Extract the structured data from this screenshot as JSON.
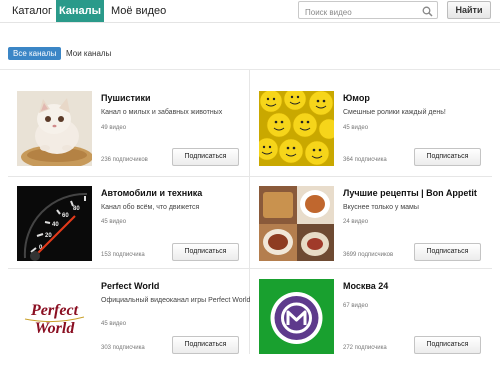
{
  "nav": {
    "tabs": [
      "Каталог",
      "Каналы",
      "Моё видео"
    ],
    "search_placeholder": "Поиск видео",
    "find_label": "Найти"
  },
  "filters": {
    "all": "Все каналы",
    "mine": "Мои каналы"
  },
  "colors": {
    "active_tab": "#2a9a8a",
    "active_pill": "#3b86c6"
  },
  "cards": [
    {
      "title": "Пушистики",
      "description": "Канал о милых и забавных животных",
      "videos": "49 видео",
      "subscribers": "236 подписчиков",
      "button": "Подписаться",
      "thumbnail": "kitten-photo"
    },
    {
      "title": "Юмор",
      "description": "Смешные ролики каждый день!",
      "videos": "45 видео",
      "subscribers": "364 подписчика",
      "button": "Подписаться",
      "thumbnail": "smiley-balls"
    },
    {
      "title": "Автомобили и техника",
      "description": "Канал обо всём, что движется",
      "videos": "45 видео",
      "subscribers": "153 подписчика",
      "button": "Подписаться",
      "thumbnail": "speedometer"
    },
    {
      "title": "Лучшие рецепты | Bon Appetit",
      "description": "Вкуснее только у мамы",
      "videos": "24 видео",
      "subscribers": "3699 подписчиков",
      "button": "Подписаться",
      "thumbnail": "food-dishes"
    },
    {
      "title": "Perfect World",
      "description": "Официальный видеоканал игры Perfect World",
      "videos": "45 видео",
      "subscribers": "303 подписчика",
      "button": "Подписаться",
      "thumbnail": "perfect-world-logo",
      "logo_text": "Perfect World"
    },
    {
      "title": "Москва 24",
      "description": "",
      "videos": "67 видео",
      "subscribers": "272 подписчика",
      "button": "Подписаться",
      "thumbnail": "moskva24-logo"
    }
  ]
}
